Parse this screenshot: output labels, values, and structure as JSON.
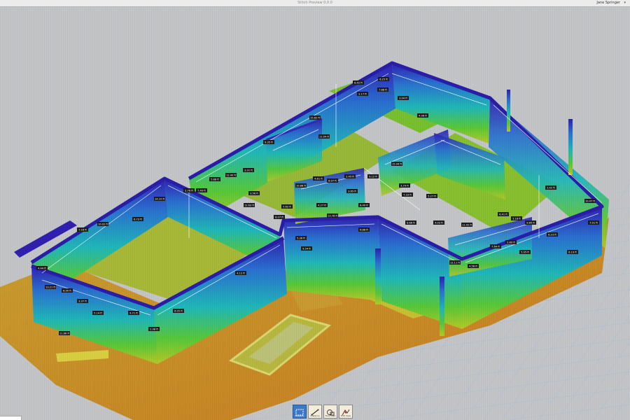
{
  "app": {
    "title": "Stitch Preview 0.0.0",
    "user": "Jane Springer"
  },
  "toolbar": {
    "tools": [
      {
        "label": "Measure",
        "icon": "select-box-icon",
        "active": true
      },
      {
        "label": "Distance",
        "icon": "distance-line-icon",
        "active": false
      },
      {
        "label": "Floor Plan",
        "icon": "floor-plan-icon",
        "active": false
      },
      {
        "label": "Edit View",
        "icon": "edit-view-icon",
        "active": false
      }
    ]
  },
  "colors": {
    "background": "#c3c5c8",
    "grid": "#a8c0d8",
    "wall_top": "#3020b0",
    "wall_mid": "#20b0c0",
    "wall_low": "#70c830",
    "floor": "#c89030",
    "floor_inner": "#a8b838"
  },
  "measurements": [
    {
      "label": "8.42 ft"
    },
    {
      "label": "6.25 ft"
    },
    {
      "label": "2.17 ft"
    },
    {
      "label": "7.88 ft"
    },
    {
      "label": "3.04 ft"
    },
    {
      "label": "15.62 ft"
    },
    {
      "label": "11.04 ft"
    },
    {
      "label": "4.96 ft"
    },
    {
      "label": "9.35 ft"
    },
    {
      "label": "12.40 ft"
    },
    {
      "label": "3.91 ft"
    },
    {
      "label": "5.88 ft"
    },
    {
      "label": "14.10 ft"
    },
    {
      "label": "2.76 ft"
    },
    {
      "label": "6.73 ft"
    },
    {
      "label": "10.02 ft"
    },
    {
      "label": "7.16 ft"
    },
    {
      "label": "4.44 ft"
    },
    {
      "label": "13.21 ft"
    },
    {
      "label": "8.90 ft"
    },
    {
      "label": "3.37 ft"
    },
    {
      "label": "5.14 ft"
    },
    {
      "label": "11.86 ft"
    },
    {
      "label": "9.71 ft"
    },
    {
      "label": "2.98 ft"
    },
    {
      "label": "6.05 ft"
    },
    {
      "label": "4.12 ft"
    },
    {
      "label": "7.49 ft"
    },
    {
      "label": "12.63 ft"
    },
    {
      "label": "3.56 ft"
    },
    {
      "label": "8.07 ft"
    },
    {
      "label": "5.62 ft"
    },
    {
      "label": "10.88 ft"
    },
    {
      "label": "4.81 ft"
    },
    {
      "label": "6.97 ft"
    },
    {
      "label": "2.45 ft"
    },
    {
      "label": "9.12 ft"
    },
    {
      "label": "3.79 ft"
    },
    {
      "label": "7.33 ft"
    },
    {
      "label": "15.04 ft"
    },
    {
      "label": "5.27 ft"
    },
    {
      "label": "8.66 ft"
    },
    {
      "label": "4.03 ft"
    },
    {
      "label": "11.42 ft"
    },
    {
      "label": "6.41 ft"
    },
    {
      "label": "3.18 ft"
    },
    {
      "label": "9.85 ft"
    },
    {
      "label": "7.64 ft"
    },
    {
      "label": "2.89 ft"
    },
    {
      "label": "5.95 ft"
    },
    {
      "label": "12.11 ft"
    },
    {
      "label": "4.58 ft"
    },
    {
      "label": "8.23 ft"
    },
    {
      "label": "6.19 ft"
    },
    {
      "label": "3.42 ft"
    },
    {
      "label": "10.47 ft"
    },
    {
      "label": "7.01 ft"
    },
    {
      "label": "5.36 ft"
    },
    {
      "label": "9.54 ft"
    },
    {
      "label": "4.27 ft"
    },
    {
      "label": "13.78 ft"
    },
    {
      "label": "6.88 ft"
    },
    {
      "label": "3.65 ft"
    },
    {
      "label": "8.49 ft"
    }
  ]
}
